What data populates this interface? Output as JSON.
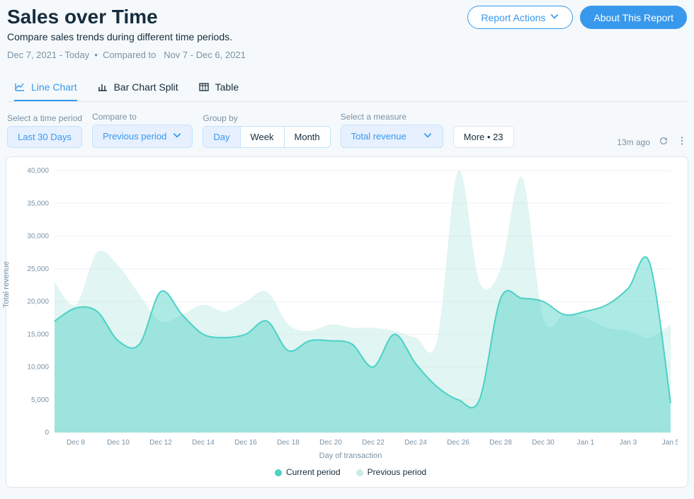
{
  "header": {
    "title": "Sales over Time",
    "subtitle": "Compare sales trends during different time periods.",
    "date_range": "Dec 7, 2021 - Today",
    "compare_prefix": "Compared to",
    "compare_range": "Nov 7 - Dec 6, 2021",
    "report_actions": "Report Actions",
    "about": "About This Report"
  },
  "tabs": {
    "line": "Line Chart",
    "bar": "Bar Chart Split",
    "table": "Table"
  },
  "controls": {
    "time_label": "Select a time period",
    "time_value": "Last 30 Days",
    "compare_label": "Compare to",
    "compare_value": "Previous period",
    "group_label": "Group by",
    "group_day": "Day",
    "group_week": "Week",
    "group_month": "Month",
    "measure_label": "Select a measure",
    "measure_value": "Total revenue",
    "more": "More • 23",
    "updated": "13m ago"
  },
  "chart": {
    "ylabel": "Total revenue",
    "xlabel": "Day of transaction",
    "legend_current": "Current period",
    "legend_previous": "Previous period",
    "color_current": "#4bd1c6",
    "color_previous": "#c9ece8"
  },
  "chart_data": {
    "type": "area",
    "xlabel": "Day of transaction",
    "ylabel": "Total revenue",
    "y_ticks": [
      0,
      5000,
      10000,
      15000,
      20000,
      25000,
      30000,
      35000,
      40000
    ],
    "ylim": [
      0,
      40000
    ],
    "x_tick_labels": [
      "Dec 8",
      "Dec 10",
      "Dec 12",
      "Dec 14",
      "Dec 16",
      "Dec 18",
      "Dec 20",
      "Dec 22",
      "Dec 24",
      "Dec 26",
      "Dec 28",
      "Dec 30",
      "Jan 1",
      "Jan 3",
      "Jan 5"
    ],
    "categories": [
      "Dec 7",
      "Dec 8",
      "Dec 9",
      "Dec 10",
      "Dec 11",
      "Dec 12",
      "Dec 13",
      "Dec 14",
      "Dec 15",
      "Dec 16",
      "Dec 17",
      "Dec 18",
      "Dec 19",
      "Dec 20",
      "Dec 21",
      "Dec 22",
      "Dec 23",
      "Dec 24",
      "Dec 25",
      "Dec 26",
      "Dec 27",
      "Dec 28",
      "Dec 29",
      "Dec 30",
      "Dec 31",
      "Jan 1",
      "Jan 2",
      "Jan 3",
      "Jan 4",
      "Jan 5"
    ],
    "series": [
      {
        "name": "Current period",
        "color": "#4bd1c6",
        "values": [
          17000,
          19000,
          18500,
          14000,
          13500,
          21500,
          18000,
          15000,
          14500,
          15000,
          17000,
          12500,
          14000,
          14000,
          13500,
          10000,
          15000,
          10500,
          7000,
          5000,
          5000,
          20500,
          20500,
          20000,
          18000,
          18500,
          19500,
          22000,
          26000,
          4500
        ]
      },
      {
        "name": "Previous period",
        "color": "#c9ece8",
        "values": [
          23000,
          19500,
          27500,
          25500,
          21000,
          17000,
          18000,
          19500,
          18500,
          20000,
          21500,
          16500,
          15500,
          16500,
          16000,
          16000,
          15500,
          14500,
          14000,
          40000,
          23000,
          25000,
          39000,
          17500,
          18000,
          17500,
          16000,
          15500,
          14500,
          16500
        ]
      }
    ]
  }
}
